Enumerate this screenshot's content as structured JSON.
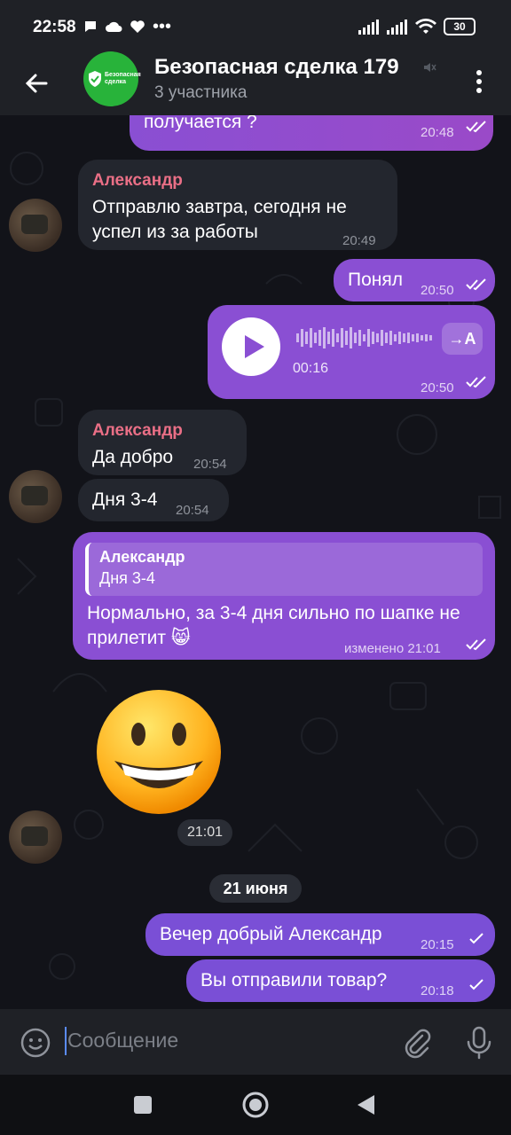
{
  "status_bar": {
    "time": "22:58",
    "battery": "30"
  },
  "header": {
    "title": "Безопасная сделка 179",
    "subtitle": "3 участника",
    "avatar_text": "Безопасная сделка"
  },
  "messages": [
    {
      "id": "m1",
      "text": "получается ?",
      "time": "20:48"
    },
    {
      "id": "m2",
      "sender": "Александр",
      "text": "Отправлю завтра, сегодня не успел из за работы",
      "time": "20:49"
    },
    {
      "id": "m3",
      "text": "Понял",
      "time": "20:50"
    },
    {
      "id": "m4",
      "type": "voice",
      "duration": "00:16",
      "transcribe": "→A",
      "time": "20:50"
    },
    {
      "id": "m5",
      "sender": "Александр",
      "text": "Да добро",
      "time": "20:54"
    },
    {
      "id": "m6",
      "text": "Дня 3-4",
      "time": "20:54"
    },
    {
      "id": "m7",
      "reply_sender": "Александр",
      "reply_text": "Дня 3-4",
      "text": "Нормально, за 3-4 дня сильно по шапке не прилетит 😸",
      "edited_time": "изменено 21:01"
    },
    {
      "id": "m8",
      "type": "sticker",
      "time": "21:01"
    },
    {
      "id": "m9",
      "text": "Вечер добрый Александр",
      "time": "20:15"
    },
    {
      "id": "m10",
      "text": "Вы отправили товар?",
      "time": "20:18"
    }
  ],
  "date_separator": "21 июня",
  "input": {
    "placeholder": "Сообщение"
  },
  "colors": {
    "outgoing": "#8a4fd3",
    "incoming": "#23262e",
    "sender_name": "#ea6f86",
    "group_avatar": "#28b33a"
  }
}
